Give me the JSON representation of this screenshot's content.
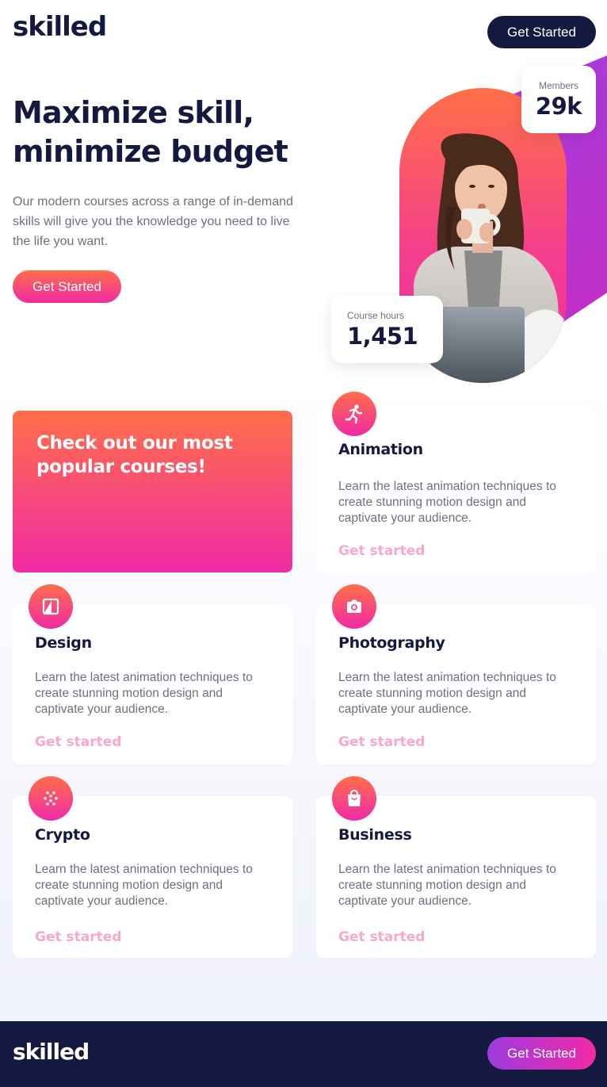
{
  "brand": {
    "logo": "skilled"
  },
  "header": {
    "cta_label": "Get Started"
  },
  "hero": {
    "title": "Maximize skill, minimize budget",
    "description": "Our modern courses across a range of in-demand skills will give you the knowledge you need to live the life you want.",
    "cta_label": "Get Started"
  },
  "stats": {
    "members": {
      "label": "Members",
      "value": "29k"
    },
    "course_hours": {
      "label": "Course hours",
      "value": "1,451"
    }
  },
  "promo": {
    "title": "Check out our most popular courses!"
  },
  "courses": [
    {
      "title": "Animation",
      "description": "Learn the latest animation techniques to create stunning motion design and captivate your audience.",
      "link": "Get started",
      "icon": "running-person-icon"
    },
    {
      "title": "Design",
      "description": "Learn the latest animation techniques to create stunning motion design and captivate your audience.",
      "link": "Get started",
      "icon": "design-icon"
    },
    {
      "title": "Photography",
      "description": "Learn the latest animation techniques to create stunning motion design and captivate your audience.",
      "link": "Get started",
      "icon": "camera-icon"
    },
    {
      "title": "Crypto",
      "description": "Learn the latest animation techniques to create stunning motion design and captivate your audience.",
      "link": "Get started",
      "icon": "crypto-icon"
    },
    {
      "title": "Business",
      "description": "Learn the latest animation techniques to create stunning motion design and captivate your audience.",
      "link": "Get started",
      "icon": "shopping-bag-icon"
    }
  ],
  "footer": {
    "logo": "skilled",
    "cta_label": "Get Started"
  },
  "colors": {
    "navy": "#14193f",
    "gradient_start": "#ff6f48",
    "gradient_end": "#f02aa6",
    "link_pink": "#f9a7cc",
    "body_text": "#6c7080"
  }
}
